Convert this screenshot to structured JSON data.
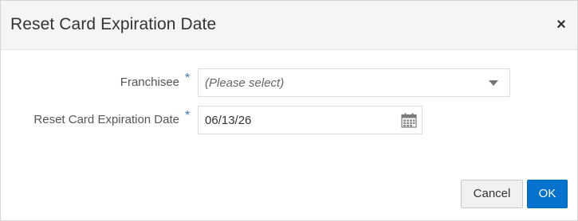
{
  "dialog": {
    "title": "Reset Card Expiration Date",
    "close_glyph": "×"
  },
  "form": {
    "franchisee": {
      "label": "Franchisee",
      "required_mark": "*",
      "placeholder": "(Please select)"
    },
    "reset_date": {
      "label": "Reset Card Expiration Date",
      "required_mark": "*",
      "value": "06/13/26",
      "icon": "calendar-icon"
    }
  },
  "footer": {
    "cancel_label": "Cancel",
    "ok_label": "OK"
  },
  "colors": {
    "accent": "#0572ce",
    "required": "#3d73b8",
    "header_bg": "#f5f5f5"
  }
}
